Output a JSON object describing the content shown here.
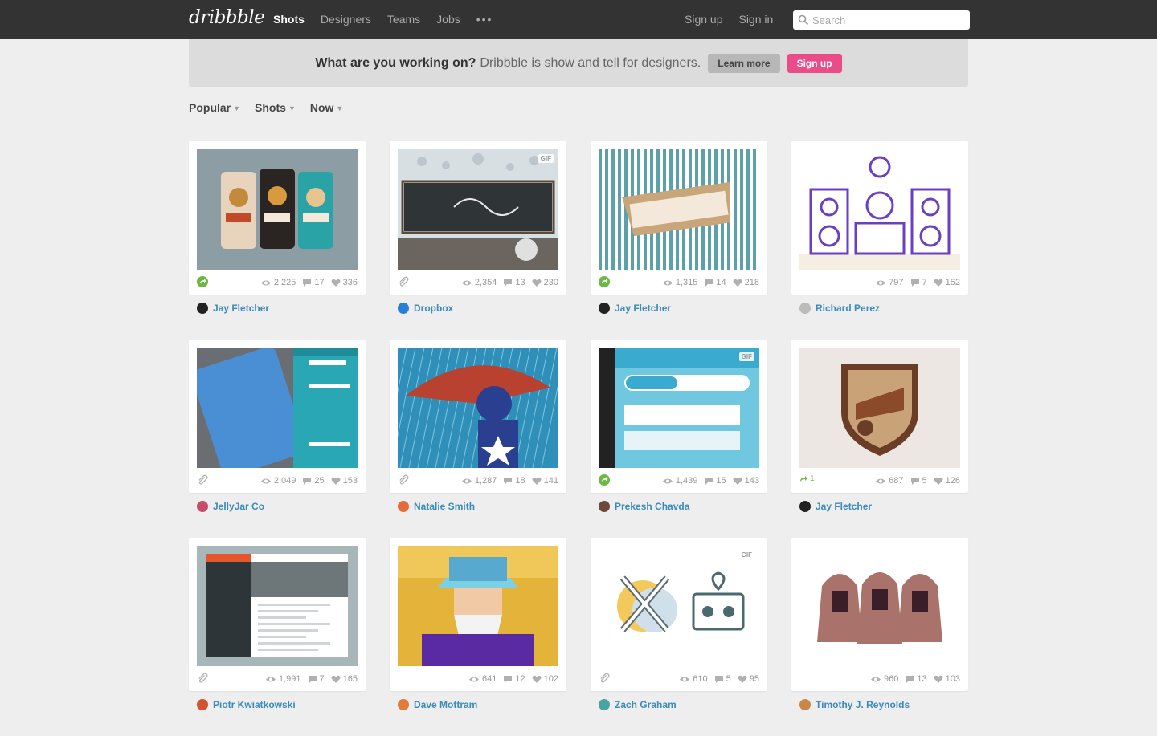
{
  "header": {
    "logo": "dribbble",
    "nav": [
      "Shots",
      "Designers",
      "Teams",
      "Jobs"
    ],
    "more": "•••",
    "sign_up": "Sign up",
    "sign_in": "Sign in",
    "search_placeholder": "Search"
  },
  "banner": {
    "question": "What are you working on?",
    "tagline": "Dribbble is show and tell for designers.",
    "learn_more": "Learn more",
    "sign_up": "Sign up"
  },
  "filters": [
    "Popular",
    "Shots",
    "Now"
  ],
  "colors": {
    "accent": "#ea4c89",
    "link": "#3a8bbb",
    "header": "#333333",
    "rebound": "#6bb843"
  },
  "shots": [
    {
      "author": "Jay Fletcher",
      "views": "2,225",
      "comments": "17",
      "likes": "336",
      "lead": "rebound",
      "gif": false,
      "art": "cans",
      "avatar": "#222"
    },
    {
      "author": "Dropbox",
      "views": "2,354",
      "comments": "13",
      "likes": "230",
      "lead": "attachment",
      "gif": true,
      "art": "chalkboard",
      "avatar": "#2a7fd4"
    },
    {
      "author": "Jay Fletcher",
      "views": "1,315",
      "comments": "14",
      "likes": "218",
      "lead": "rebound",
      "gif": false,
      "art": "stripes",
      "avatar": "#222"
    },
    {
      "author": "Richard Perez",
      "views": "797",
      "comments": "7",
      "likes": "152",
      "lead": "",
      "gif": false,
      "art": "dj",
      "avatar": "#bbb"
    },
    {
      "author": "JellyJar Co",
      "views": "2,049",
      "comments": "25",
      "likes": "153",
      "lead": "attachment",
      "gif": false,
      "art": "phone",
      "avatar": "#c94b6b"
    },
    {
      "author": "Natalie Smith",
      "views": "1,287",
      "comments": "18",
      "likes": "141",
      "lead": "attachment",
      "gif": false,
      "art": "captain",
      "avatar": "#e46b3c"
    },
    {
      "author": "Prekesh Chavda",
      "views": "1,439",
      "comments": "15",
      "likes": "143",
      "lead": "rebound",
      "gif": true,
      "art": "journey",
      "avatar": "#6b4a3a"
    },
    {
      "author": "Jay Fletcher",
      "views": "687",
      "comments": "5",
      "likes": "126",
      "lead": "rebound-1",
      "gif": false,
      "art": "shield",
      "avatar": "#222"
    },
    {
      "author": "Piotr Kwiatkowski",
      "views": "1,991",
      "comments": "7",
      "likes": "165",
      "lead": "attachment",
      "gif": false,
      "art": "dashboard",
      "avatar": "#d2532e"
    },
    {
      "author": "Dave Mottram",
      "views": "641",
      "comments": "12",
      "likes": "102",
      "lead": "",
      "gif": false,
      "art": "wizard",
      "avatar": "#e07b39"
    },
    {
      "author": "Zach Graham",
      "views": "610",
      "comments": "5",
      "likes": "95",
      "lead": "attachment",
      "gif": true,
      "art": "knives",
      "avatar": "#4aa3a3"
    },
    {
      "author": "Timothy J. Reynolds",
      "views": "960",
      "comments": "13",
      "likes": "103",
      "lead": "",
      "gif": false,
      "art": "heads",
      "avatar": "#c9884a"
    }
  ],
  "labels": {
    "gif": "GIF",
    "rebound_count": "1"
  }
}
